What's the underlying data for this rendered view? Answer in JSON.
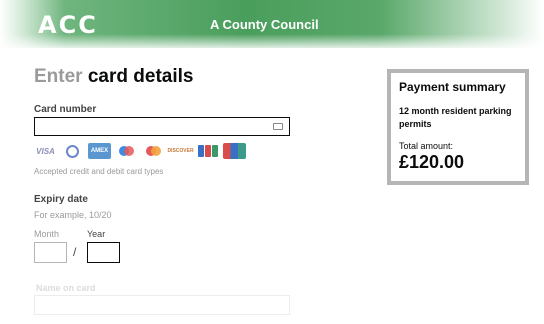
{
  "header": {
    "logo": "ACC",
    "council_name": "A County Council"
  },
  "form": {
    "title_faded": "Enter",
    "title_rest": " card details",
    "card_number": {
      "label": "Card number",
      "value": ""
    },
    "accepted_cards": [
      "VISA",
      "Diners",
      "AMEX",
      "Maestro",
      "Mastercard",
      "DISCOVER",
      "JCB",
      "UnionPay"
    ],
    "accepted_hint": "Accepted credit and debit card types",
    "expiry": {
      "label": "Expiry date",
      "hint": "For example, 10/20",
      "month_label": "Month",
      "year_label": "Year",
      "separator": "/"
    },
    "name_on_card": {
      "label": "Name on card"
    }
  },
  "summary": {
    "title": "Payment summary",
    "description": "12 month resident parking permits",
    "total_label": "Total amount:",
    "total_amount": "£120.00"
  },
  "colors": {
    "header_green": "#4a9e5c",
    "summary_border": "#b5b5b5",
    "text": "#0b0c0c"
  }
}
